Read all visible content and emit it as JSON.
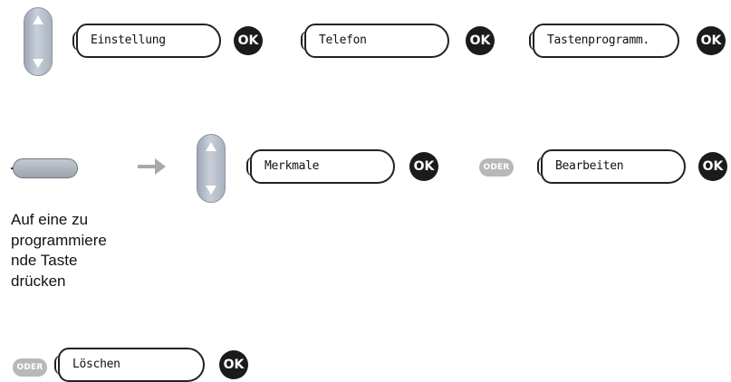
{
  "row1": {
    "keys": [
      "Einstellung",
      "Telefon",
      "Tastenprogramm."
    ],
    "ok_label": "OK"
  },
  "row2": {
    "keys": [
      "Merkmale",
      "Bearbeiten"
    ],
    "ok_label": "OK",
    "or_label": "ODER"
  },
  "instruction": [
    "Auf eine zu",
    "programmiere",
    "nde Taste",
    "drücken"
  ],
  "row3": {
    "keys": [
      "Löschen"
    ],
    "ok_label": "OK",
    "or_label": "ODER"
  },
  "icons": {
    "navigator": "up-down-scroll-icon",
    "programmable_key": "programmable-key-icon",
    "arrow": "arrow-right-icon"
  },
  "colors": {
    "ok_button": "#1b1b1b",
    "or_badge": "#b8b8b8",
    "arrow": "#a8a8a8"
  }
}
